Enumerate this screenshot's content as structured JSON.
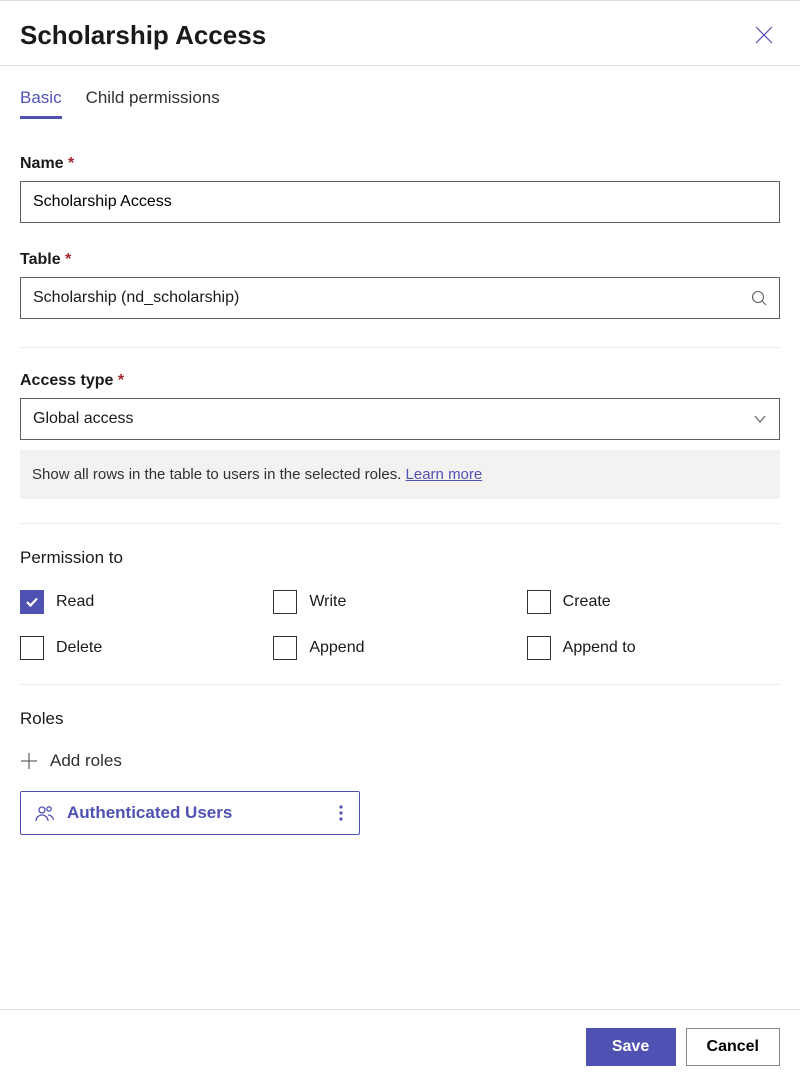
{
  "header": {
    "title": "Scholarship Access"
  },
  "tabs": {
    "basic": "Basic",
    "child": "Child permissions"
  },
  "fields": {
    "name_label": "Name",
    "name_value": "Scholarship Access",
    "table_label": "Table",
    "table_value": "Scholarship (nd_scholarship)",
    "access_label": "Access type",
    "access_value": "Global access",
    "info_text": "Show all rows in the table to users in the selected roles. ",
    "learn_more": "Learn more"
  },
  "permissions": {
    "section_title": "Permission to",
    "items": [
      {
        "label": "Read",
        "checked": true
      },
      {
        "label": "Write",
        "checked": false
      },
      {
        "label": "Create",
        "checked": false
      },
      {
        "label": "Delete",
        "checked": false
      },
      {
        "label": "Append",
        "checked": false
      },
      {
        "label": "Append to",
        "checked": false
      }
    ]
  },
  "roles": {
    "section_title": "Roles",
    "add_label": "Add roles",
    "chip": "Authenticated Users"
  },
  "footer": {
    "save": "Save",
    "cancel": "Cancel"
  }
}
